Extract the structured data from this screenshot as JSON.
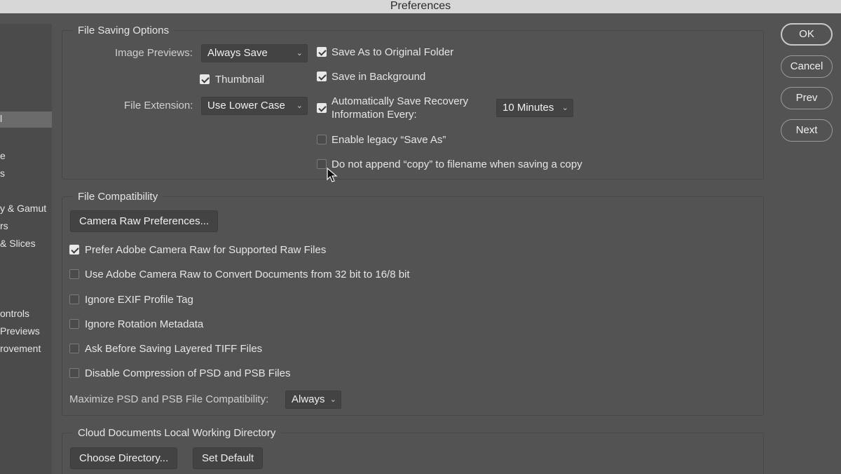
{
  "window": {
    "title": "Preferences"
  },
  "sidebar": {
    "items": [
      {
        "label": "l",
        "selected": true
      },
      {
        "label": "e"
      },
      {
        "label": "s"
      },
      {
        "label": "y & Gamut"
      },
      {
        "label": "rs"
      },
      {
        "label": "& Slices"
      },
      {
        "label": "ontrols"
      },
      {
        "label": "Previews"
      },
      {
        "label": "rovement"
      }
    ]
  },
  "file_saving": {
    "title": "File Saving Options",
    "image_previews_label": "Image Previews:",
    "image_previews_value": "Always Save",
    "thumbnail_label": "Thumbnail",
    "thumbnail_checked": true,
    "file_extension_label": "File Extension:",
    "file_extension_value": "Use Lower Case",
    "save_as_original_label": "Save As to Original Folder",
    "save_in_background_label": "Save in Background",
    "auto_save_label_1": "Automatically Save Recovery",
    "auto_save_label_2": "Information Every:",
    "auto_save_interval": "10 Minutes",
    "legacy_save_as_label": "Enable legacy “Save As”",
    "no_copy_append_label": "Do not append “copy” to filename when saving a copy"
  },
  "file_compat": {
    "title": "File Compatibility",
    "camera_raw_prefs_button": "Camera Raw Preferences...",
    "options": [
      {
        "label": "Prefer Adobe Camera Raw for Supported Raw Files",
        "checked": true
      },
      {
        "label": "Use Adobe Camera Raw to Convert Documents from 32 bit to 16/8 bit",
        "checked": false
      },
      {
        "label": "Ignore EXIF Profile Tag",
        "checked": false
      },
      {
        "label": "Ignore Rotation Metadata",
        "checked": false
      },
      {
        "label": "Ask Before Saving Layered TIFF Files",
        "checked": false
      },
      {
        "label": "Disable Compression of PSD and PSB Files",
        "checked": false
      }
    ],
    "maximize_label": "Maximize PSD and PSB File Compatibility:",
    "maximize_value": "Always"
  },
  "cloud_docs": {
    "title": "Cloud Documents Local Working Directory",
    "choose_button": "Choose Directory...",
    "default_button": "Set Default"
  },
  "actions": {
    "ok": "OK",
    "cancel": "Cancel",
    "prev": "Prev",
    "next": "Next"
  },
  "icons": {
    "dropdown": "chevron-down-icon",
    "cursor": "mouse-pointer-icon"
  },
  "colors": {
    "background": "#535353",
    "sidebar": "#4b4b4b",
    "titlebar": "#d7d7d7",
    "control": "#434343"
  }
}
